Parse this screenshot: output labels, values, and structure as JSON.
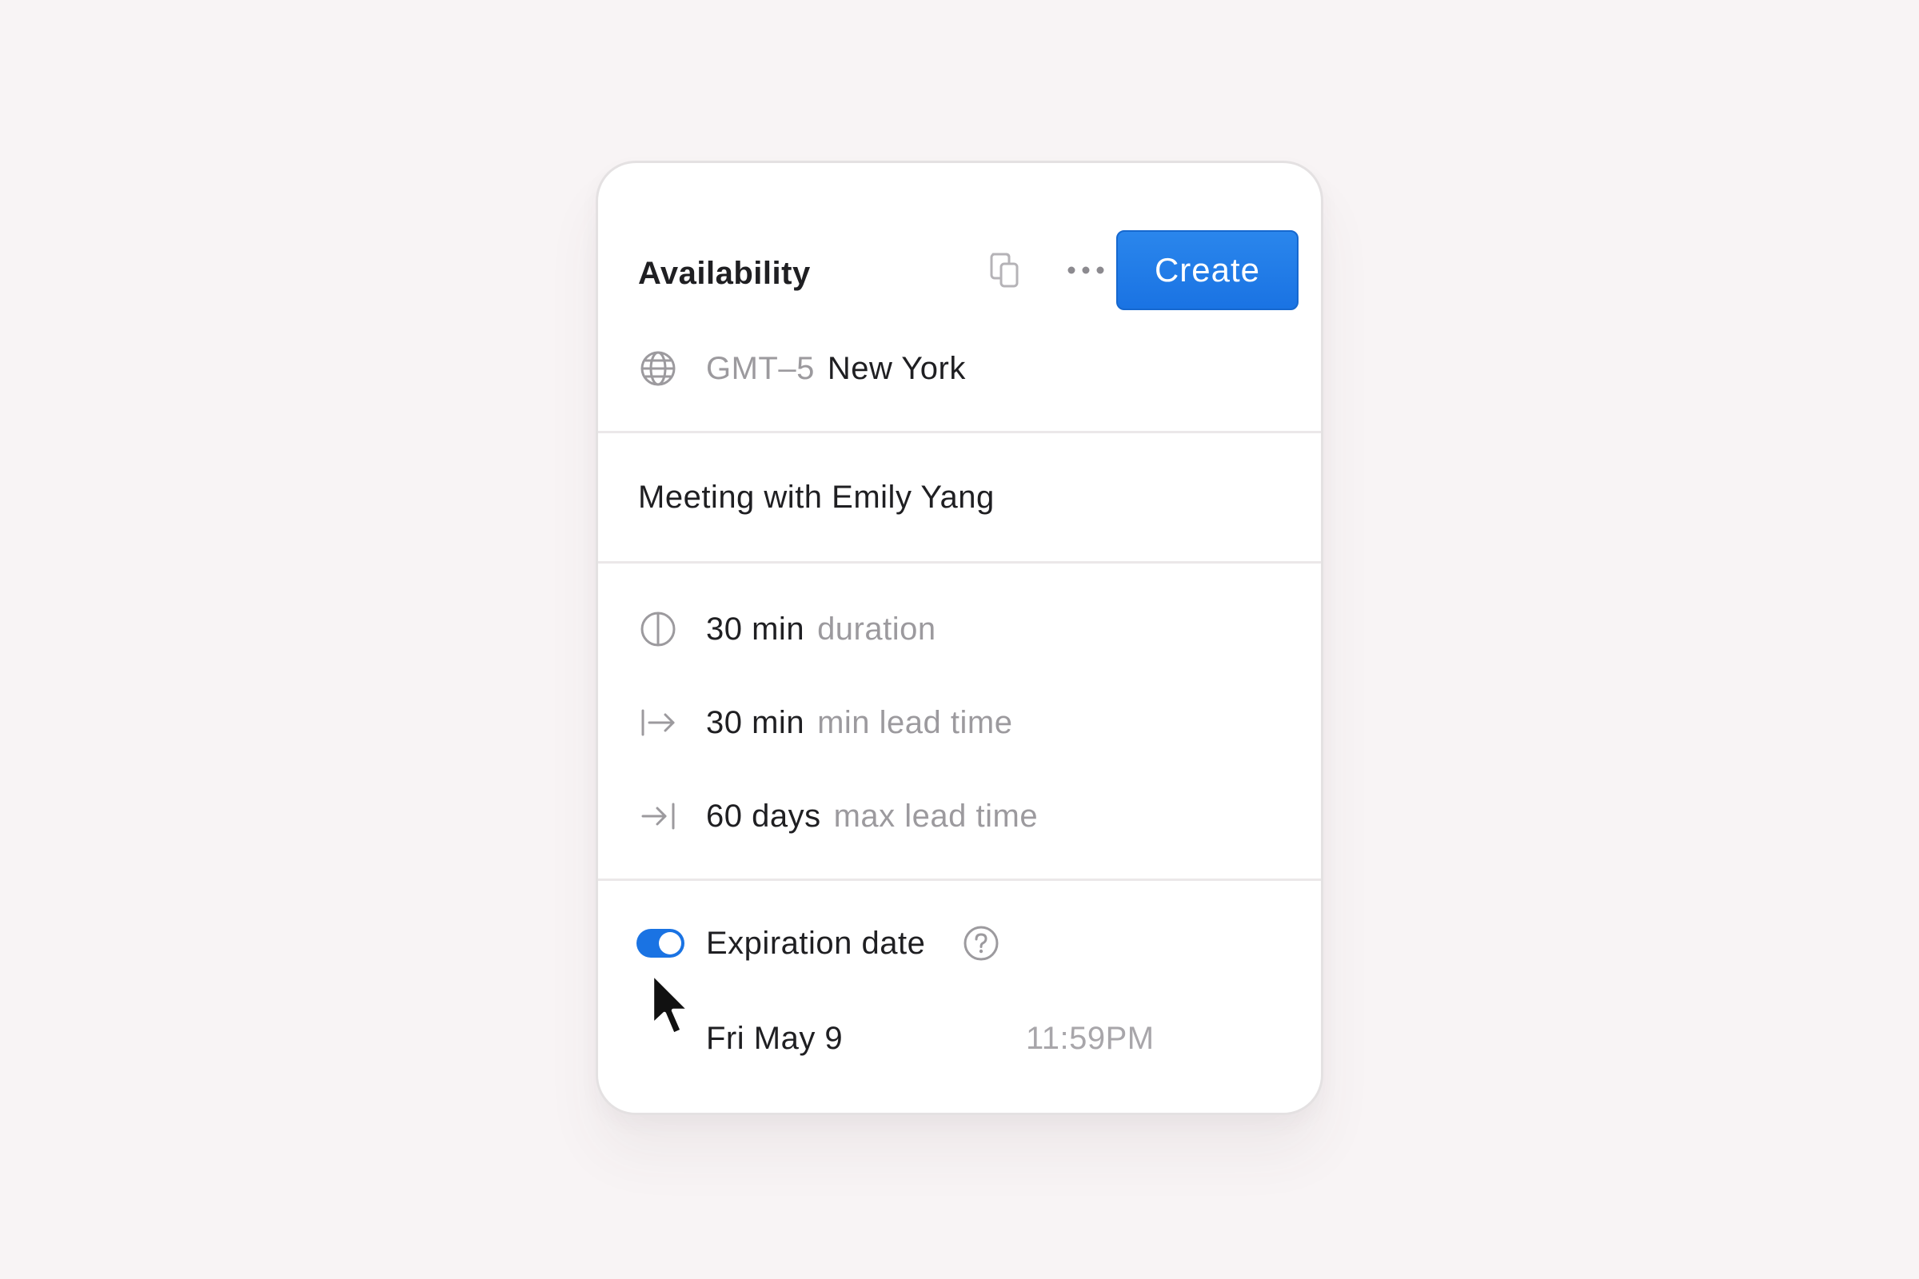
{
  "header": {
    "title": "Availability",
    "copy_icon": "copy-icon",
    "more_icon": "more-horizontal-icon",
    "create_label": "Create"
  },
  "timezone": {
    "icon": "globe-icon",
    "offset": "GMT–5",
    "city": "New York"
  },
  "meeting": {
    "title": "Meeting with Emily Yang"
  },
  "settings": [
    {
      "icon": "half-circle-icon",
      "value": "30 min",
      "label": "duration"
    },
    {
      "icon": "arrow-from-bar-icon",
      "value": "30 min",
      "label": "min lead time"
    },
    {
      "icon": "arrow-to-bar-icon",
      "value": "60 days",
      "label": "max lead time"
    }
  ],
  "expiration": {
    "enabled": true,
    "label": "Expiration date",
    "help_icon": "help-icon",
    "date": "Fri May 9",
    "time": "11:59PM"
  },
  "colors": {
    "accent": "#1a73e3",
    "background": "#f8f4f5",
    "card": "#ffffff",
    "muted_text": "#9c9a9e"
  }
}
